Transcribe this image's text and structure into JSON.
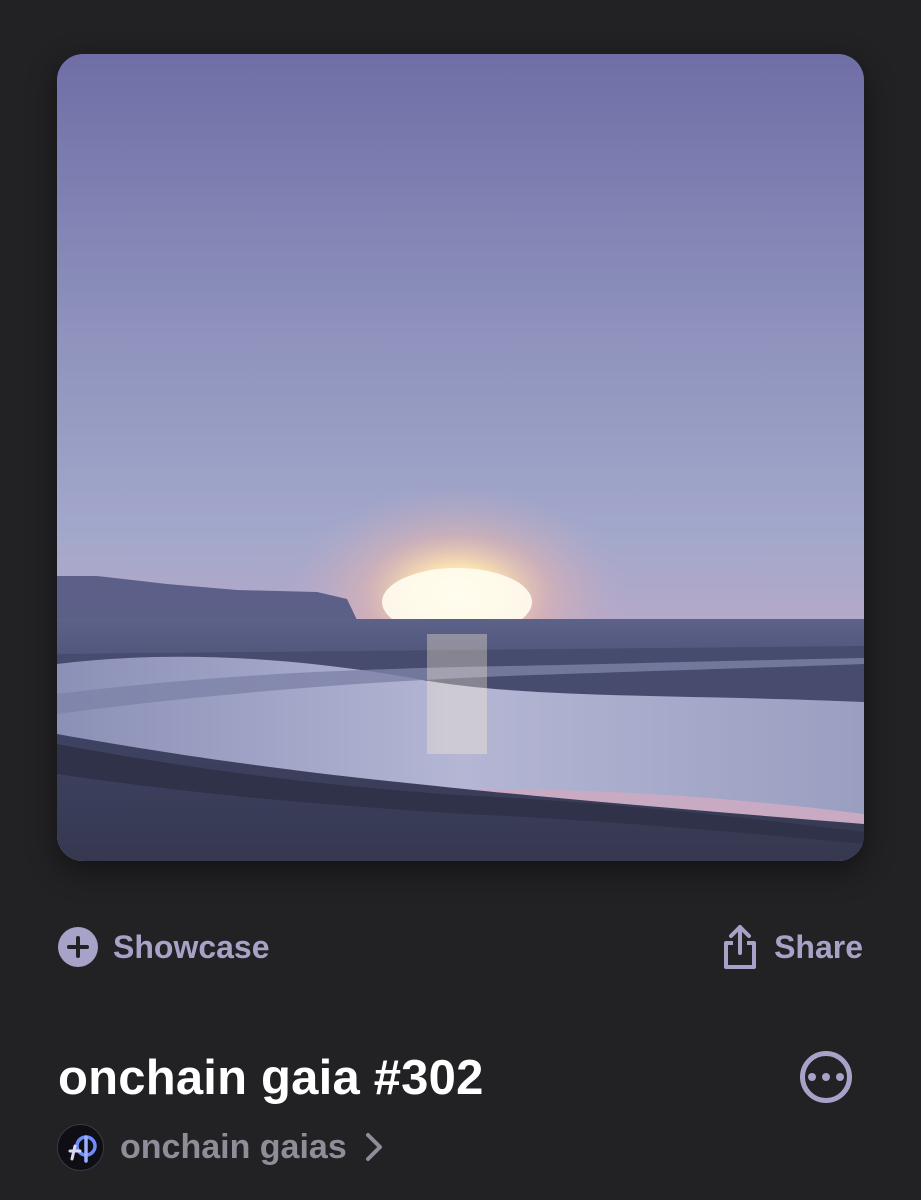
{
  "actions": {
    "showcase_label": "Showcase",
    "share_label": "Share"
  },
  "nft": {
    "title": "onchain gaia #302"
  },
  "collection": {
    "name": "onchain gaias"
  },
  "icons": {
    "showcase": "plus-circle-icon",
    "share": "share-icon",
    "more": "ellipsis-circle-icon",
    "chevron": "chevron-right-icon"
  },
  "colors": {
    "background": "#222124",
    "accent": "#a7a3c8",
    "title": "#ffffff",
    "muted": "#8f8d97"
  }
}
